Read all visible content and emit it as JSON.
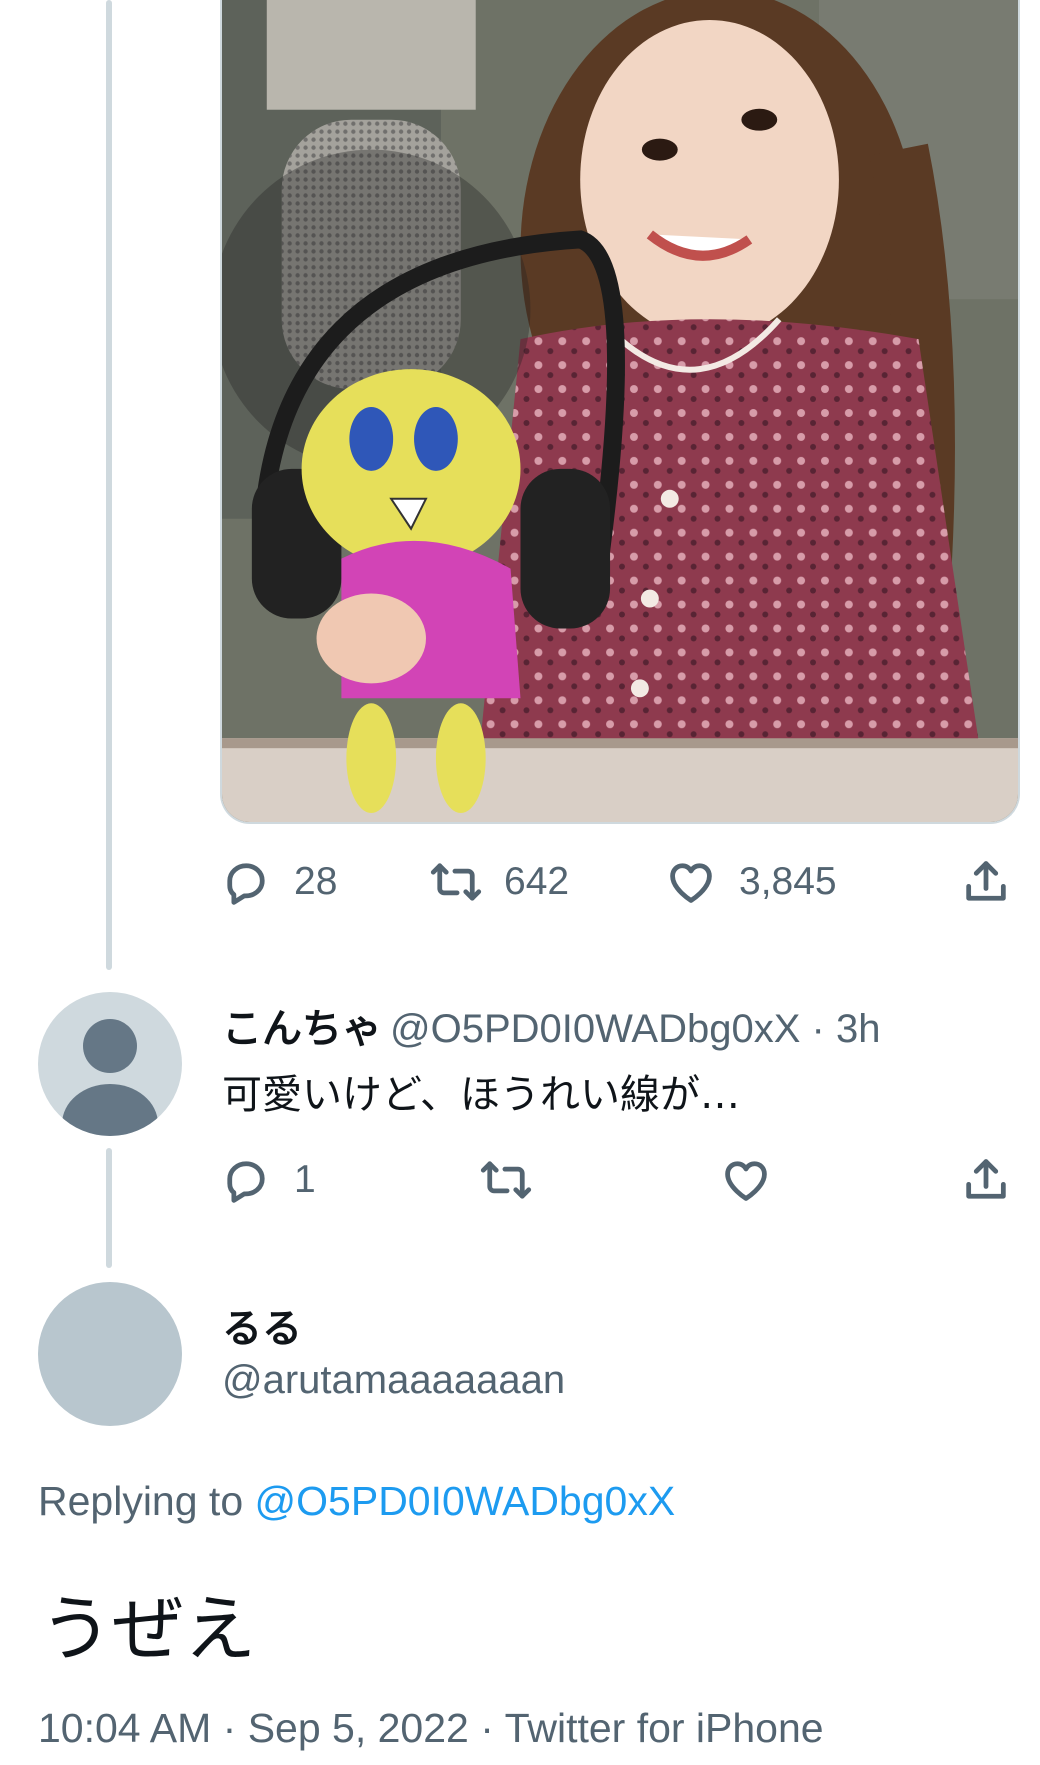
{
  "top_tweet": {
    "media_alt": "",
    "actions": {
      "reply_count": "28",
      "retweet_count": "642",
      "like_count": "3,845"
    }
  },
  "reply": {
    "display_name": "こんちゃ",
    "handle": "@O5PD0I0WADbg0xX",
    "separator": "·",
    "time_ago": "3h",
    "text": "可愛いけど、ほうれい線が…",
    "actions": {
      "reply_count": "1",
      "retweet_count": "",
      "like_count": ""
    }
  },
  "main_tweet": {
    "display_name": "るる",
    "handle": "@arutamaaaaaaan",
    "replying_prefix": "Replying to",
    "replying_to": "@O5PD0I0WADbg0xX",
    "text": "うぜえ",
    "time": "10:04 AM",
    "date": "Sep 5, 2022",
    "source": "Twitter for iPhone",
    "separator": "·"
  },
  "icons": [
    "reply-icon",
    "retweet-icon",
    "like-icon",
    "share-icon",
    "default-avatar-icon"
  ],
  "colors": {
    "text": "#0f1419",
    "secondary": "#536471",
    "link": "#1d9bf0",
    "border": "#cfd9de"
  }
}
